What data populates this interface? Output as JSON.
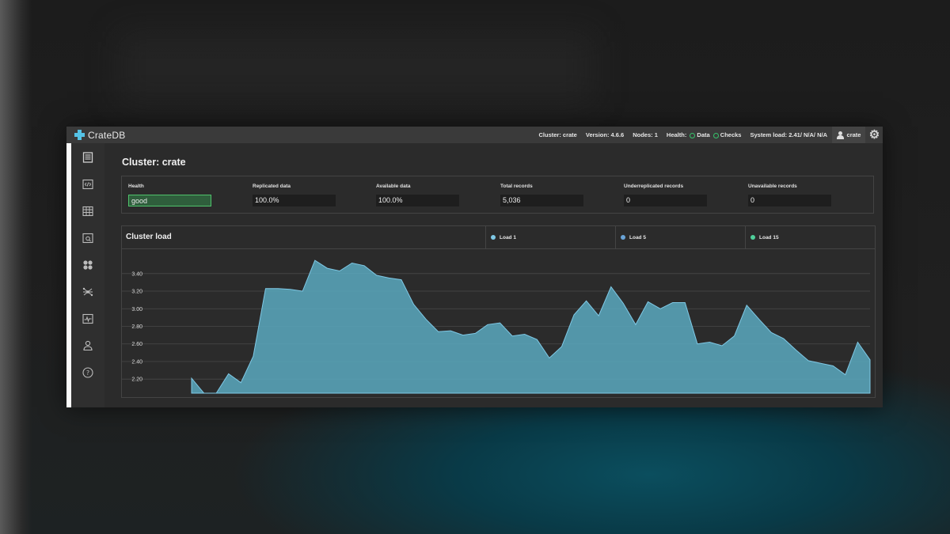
{
  "app": {
    "name": "CrateDB"
  },
  "topbar": {
    "cluster": "Cluster: crate",
    "version": "Version: 4.6.6",
    "nodes": "Nodes: 1",
    "health_label": "Health:",
    "health_data": "Data",
    "health_checks": "Checks",
    "system_load": "System load: 2.41/ N/A/ N/A",
    "user": "crate"
  },
  "sidebar": {
    "items": [
      {
        "icon": "overview-icon"
      },
      {
        "icon": "console-icon"
      },
      {
        "icon": "tables-icon"
      },
      {
        "icon": "views-icon"
      },
      {
        "icon": "shards-icon"
      },
      {
        "icon": "cluster-icon"
      },
      {
        "icon": "monitoring-icon"
      },
      {
        "icon": "users-icon"
      },
      {
        "icon": "help-icon"
      }
    ]
  },
  "page": {
    "title": "Cluster: crate"
  },
  "stats": [
    {
      "label": "Health",
      "value": "good"
    },
    {
      "label": "Replicated data",
      "value": "100.0%"
    },
    {
      "label": "Available data",
      "value": "100.0%"
    },
    {
      "label": "Total records",
      "value": "5,036"
    },
    {
      "label": "Underreplicated records",
      "value": "0"
    },
    {
      "label": "Unavailable records",
      "value": "0"
    }
  ],
  "load": {
    "title": "Cluster load",
    "legend": [
      {
        "name": "Load 1",
        "color": "#7fc9e6"
      },
      {
        "name": "Load 5",
        "color": "#6aa4d8"
      },
      {
        "name": "Load 15",
        "color": "#4fcf9a"
      }
    ]
  },
  "colors": {
    "accent": "#55c3e6",
    "good": "#4fc36b",
    "area": "#5aa9c0"
  },
  "chart_data": {
    "type": "area",
    "series": [
      {
        "name": "Load 1",
        "values": [
          2.21,
          2.04,
          2.04,
          2.26,
          2.16,
          2.46,
          3.23,
          3.23,
          3.22,
          3.2,
          3.55,
          3.46,
          3.43,
          3.52,
          3.49,
          3.38,
          3.35,
          3.33,
          3.05,
          2.88,
          2.74,
          2.75,
          2.7,
          2.72,
          2.82,
          2.84,
          2.69,
          2.71,
          2.65,
          2.44,
          2.57,
          2.93,
          3.09,
          2.92,
          3.25,
          3.06,
          2.82,
          3.08,
          3.0,
          3.07,
          3.07,
          2.6,
          2.62,
          2.58,
          2.69,
          3.04,
          2.88,
          2.73,
          2.66,
          2.53,
          2.41,
          2.38,
          2.35,
          2.25,
          2.62,
          2.42
        ]
      }
    ],
    "yticks": [
      2.2,
      2.4,
      2.6,
      2.8,
      3.0,
      3.2,
      3.4
    ],
    "ylim": [
      2.04,
      3.65
    ],
    "grid": true
  }
}
